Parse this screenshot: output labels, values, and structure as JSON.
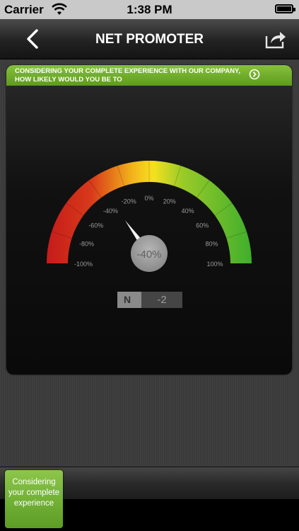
{
  "status_bar": {
    "carrier": "Carrier",
    "time": "1:38 PM"
  },
  "nav": {
    "title": "NET PROMOTER",
    "back_icon": "chevron-left-icon",
    "share_icon": "share-icon"
  },
  "question": {
    "text": "CONSIDERING YOUR COMPLETE EXPERIENCE WITH OUR COMPANY, HOW LIKELY WOULD YOU BE TO",
    "accent": "#6fab2a"
  },
  "gauge": {
    "value": -40,
    "value_label": "-40%",
    "min": -100,
    "max": 100,
    "tick_labels": [
      "-100%",
      "-80%",
      "-60%",
      "-40%",
      "-20%",
      "0%",
      "20%",
      "40%",
      "60%",
      "80%",
      "100%"
    ],
    "colors": {
      "low": "#d42020",
      "mid": "#f5e21a",
      "high": "#4caf2a"
    }
  },
  "nps_box": {
    "tag": "N",
    "value": "-2"
  },
  "bottom_tab": {
    "label": "Considering your complete experience"
  }
}
